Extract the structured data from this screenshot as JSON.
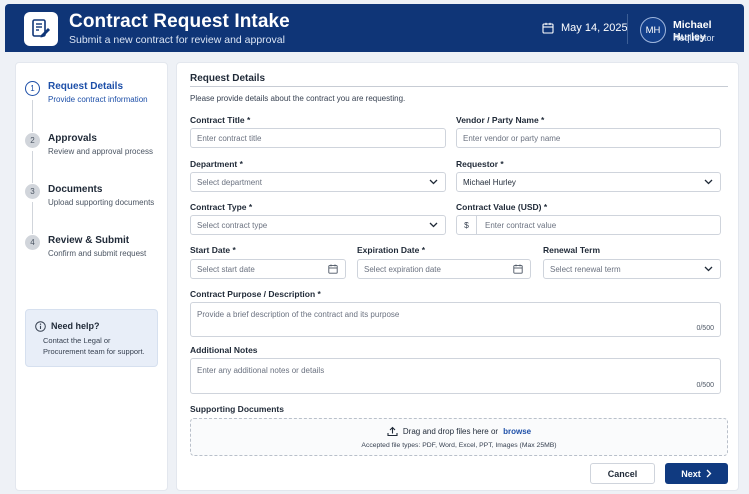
{
  "header": {
    "title": "Contract Request Intake",
    "subtitle": "Submit a new contract for review and approval",
    "date": "May 14, 2025",
    "user": {
      "initials": "MH",
      "name": "Michael Hurley",
      "role": "Requestor"
    }
  },
  "sidebar": {
    "steps": [
      {
        "number": "1",
        "title": "Request Details",
        "description": "Provide contract information"
      },
      {
        "number": "2",
        "title": "Approvals",
        "description": "Review and approval process"
      },
      {
        "number": "3",
        "title": "Documents",
        "description": "Upload supporting documents"
      },
      {
        "number": "4",
        "title": "Review & Submit",
        "description": "Confirm and submit request"
      }
    ],
    "active_step": 1,
    "help": {
      "title": "Need help?",
      "text": "Contact the Legal or Procurement team for support."
    }
  },
  "form": {
    "section_title": "Request Details",
    "intro": "Please provide details about the contract you are requesting.",
    "contract_title": {
      "label": "Contract Title *",
      "placeholder": "Enter contract title"
    },
    "vendor": {
      "label": "Vendor / Party Name *",
      "placeholder": "Enter vendor or party name"
    },
    "department": {
      "label": "Department *",
      "placeholder": "Select department"
    },
    "requestor": {
      "label": "Requestor *",
      "value": "Michael Hurley"
    },
    "contract_type": {
      "label": "Contract Type *",
      "placeholder": "Select contract type"
    },
    "contract_value": {
      "label": "Contract Value (USD)  *",
      "prefix": "$",
      "placeholder": "Enter contract value"
    },
    "start_date": {
      "label": "Start Date *",
      "placeholder": "Select start date"
    },
    "expiration_date": {
      "label": "Expiration Date *",
      "placeholder": "Select expiration date"
    },
    "renewal_term": {
      "label": "Renewal Term",
      "placeholder": "Select renewal term"
    },
    "purpose": {
      "label": "Contract Purpose / Description *",
      "placeholder": "Provide a brief description of the contract and its purpose",
      "counter": "0/500"
    },
    "notes": {
      "label": "Additional Notes",
      "placeholder": "Enter any additional notes or details",
      "counter": "0/500"
    },
    "documents": {
      "label": "Supporting Documents",
      "drop_text": "Drag and drop files here or",
      "browse": "browse",
      "accepted": "Accepted file types: PDF, Word, Excel, PPT, Images (Max 25MB)"
    }
  },
  "actions": {
    "cancel": "Cancel",
    "next": "Next"
  },
  "colors": {
    "header_bg": "#0f3577",
    "accent": "#1d4fa8",
    "primary_button": "#103a80"
  },
  "icons": {
    "logo": "document-pen-icon",
    "date": "calendar-icon",
    "dropdown": "chevron-down-icon",
    "date_picker": "calendar-icon",
    "help": "info-icon",
    "upload": "upload-icon",
    "next": "chevron-right-icon"
  }
}
